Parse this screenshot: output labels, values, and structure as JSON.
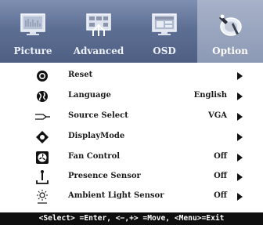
{
  "tabs": [
    {
      "label": "Picture",
      "icon": "picture-monitor-icon"
    },
    {
      "label": "Advanced",
      "icon": "advanced-sliders-icon"
    },
    {
      "label": "OSD",
      "icon": "osd-screen-icon"
    },
    {
      "label": "Option",
      "icon": "option-wrench-icon",
      "selected": true
    }
  ],
  "items": [
    {
      "label": "Reset",
      "icon": "reset-icon",
      "value": ""
    },
    {
      "label": "Language",
      "icon": "globe-icon",
      "value": "English"
    },
    {
      "label": "Source Select",
      "icon": "source-select-icon",
      "value": "VGA"
    },
    {
      "label": "DisplayMode",
      "icon": "display-mode-icon",
      "value": ""
    },
    {
      "label": "Fan Control",
      "icon": "fan-icon",
      "value": "Off"
    },
    {
      "label": "Presence Sensor",
      "icon": "presence-sensor-icon",
      "value": "Off"
    },
    {
      "label": "Ambient Light Sensor",
      "icon": "ambient-light-icon",
      "value": "Off"
    }
  ],
  "footer": {
    "hint": "<Select> =Enter, <−,+> =Move, <Menu>=Exit"
  },
  "colors": {
    "tab_bar": "#5d6f93",
    "active_tab": "#8c99b5",
    "footer_bg": "#0f0f0f"
  }
}
